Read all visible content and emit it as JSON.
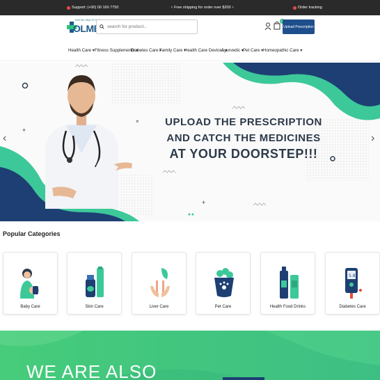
{
  "topbar": {
    "support": "Support: (+00) 00 160 7750",
    "promo": "Free shipping for order over $200",
    "order_tracking": "Order tracking"
  },
  "header": {
    "logo_tagline": "DIGITAL HEALTH HUB",
    "logo_word": "OLMED",
    "search_placeholder": "search for product...",
    "cart_count": "0",
    "upload_button": "Upload Prescription"
  },
  "nav": {
    "items": [
      {
        "label": "Health Care"
      },
      {
        "label": "Fitness Supplements"
      },
      {
        "label": "Diabetes Care"
      },
      {
        "label": "Family Care"
      },
      {
        "label": "Health Care Devices"
      },
      {
        "label": "Ayurvedic"
      },
      {
        "label": "Pet Care"
      },
      {
        "label": "Homeopathic Care"
      }
    ]
  },
  "hero": {
    "line1": "UPLOAD THE PRESCRIPTION",
    "line2": "AND CATCH THE MEDICINES",
    "line3": "AT YOUR DOORSTEP!!!"
  },
  "categories": {
    "title": "Popular Categories",
    "items": [
      {
        "label": "Baby Care",
        "icon": "baby-icon"
      },
      {
        "label": "Skin Care",
        "icon": "skin-care-icon"
      },
      {
        "label": "Liver Care",
        "icon": "liver-care-icon"
      },
      {
        "label": "Pet Care",
        "icon": "pet-food-icon"
      },
      {
        "label": "Health Food Drinks",
        "icon": "health-drink-icon"
      },
      {
        "label": "Diabetes Care",
        "icon": "glucometer-icon"
      }
    ]
  },
  "banner2": {
    "text": "WE ARE ALSO"
  },
  "colors": {
    "topbar": "#2a2a2a",
    "brand_blue": "#1e4f8c",
    "brand_green": "#2ec27e",
    "hero_navy": "#1d3f73",
    "hero_teal": "#3dc89a"
  }
}
